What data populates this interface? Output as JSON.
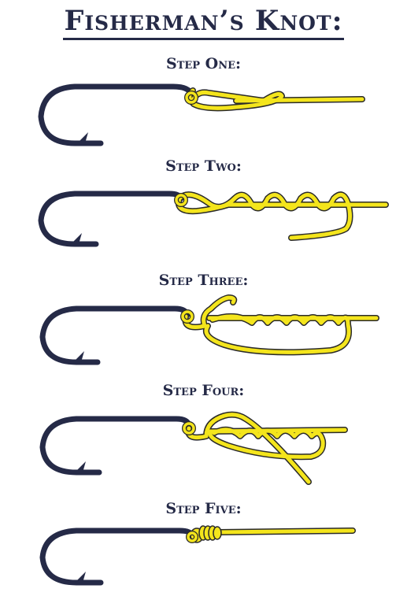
{
  "title": "Fisherman’s Knot:",
  "steps": [
    {
      "label": "Step One:"
    },
    {
      "label": "Step Two:"
    },
    {
      "label": "Step Three:"
    },
    {
      "label": "Step Four:"
    },
    {
      "label": "Step Five:"
    }
  ],
  "colors": {
    "hook": "#252a47",
    "line": "#f4e51c",
    "line_outline": "#2a2a2a",
    "text": "#252a47"
  }
}
